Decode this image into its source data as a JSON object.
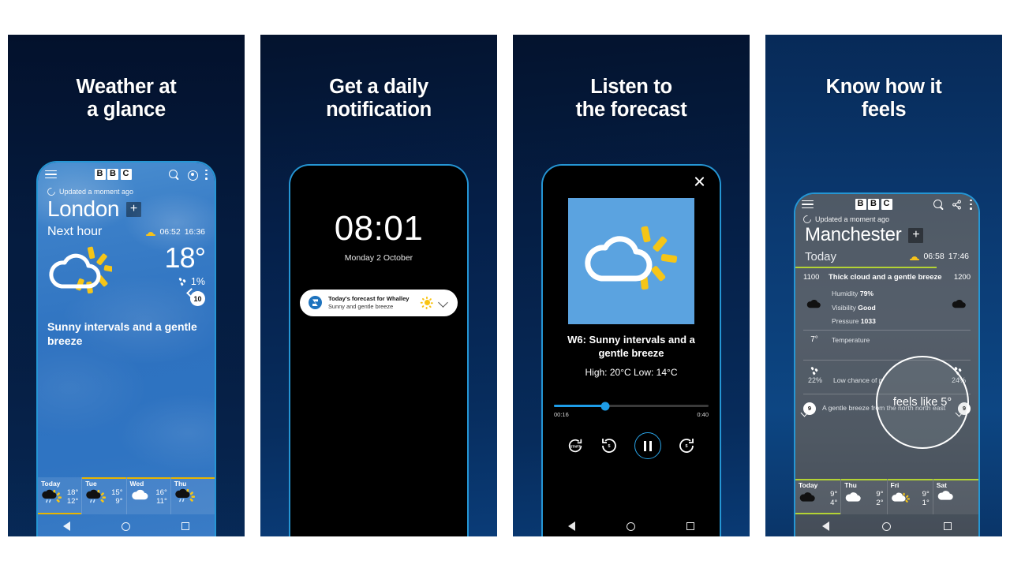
{
  "panels": [
    {
      "id": "weather-at-a-glance",
      "headline": "Weather at\na glance",
      "app": {
        "brand": [
          "B",
          "B",
          "C"
        ],
        "menu_icon": "hamburger-icon",
        "search_icon": "search-icon",
        "location_icon": "location-target-icon",
        "overflow_icon": "more-vertical-icon",
        "updated": "Updated a moment ago",
        "city": "London",
        "add_label": "+",
        "section_label": "Next hour",
        "sunrise": "06:52",
        "sunset": "16:36",
        "temperature": "18°",
        "rain_chance": "1%",
        "wind_speed": "10",
        "summary": "Sunny intervals and\na gentle breeze"
      },
      "forecast": [
        {
          "day": "Today",
          "icon": "sun-rain-cloud",
          "high": "18°",
          "low": "12°",
          "active": true
        },
        {
          "day": "Tue",
          "icon": "sun-rain-cloud",
          "high": "15°",
          "low": "9°",
          "active": false
        },
        {
          "day": "Wed",
          "icon": "cloud",
          "high": "16°",
          "low": "11°",
          "active": false
        },
        {
          "day": "Thu",
          "icon": "sun-rain-cloud",
          "high": "",
          "low": "",
          "active": false
        }
      ]
    },
    {
      "id": "daily-notification",
      "headline": "Get a daily\nnotification",
      "lock": {
        "clock": "08:01",
        "date": "Monday 2 October"
      },
      "notification": {
        "app_icon": "bbc-weather-app-icon",
        "title": "Today's forecast for Whalley",
        "subtitle": "Sunny and gentle breeze",
        "weather_icon": "sun-icon",
        "expand_icon": "chevron-down-icon"
      }
    },
    {
      "id": "listen-to-forecast",
      "headline": "Listen to\nthe forecast",
      "player": {
        "close_icon": "close-icon",
        "artwork_icon": "sun-behind-cloud-icon",
        "title": "W6: Sunny intervals\nand a gentle breeze",
        "subtitle": "High: 20°C  Low: 14°C",
        "elapsed": "00:16",
        "duration": "0:40",
        "progress_pct": 33,
        "restart_label": "START",
        "rewind_label": "5",
        "forward_label": "5",
        "play_state": "pause"
      }
    },
    {
      "id": "know-how-it-feels",
      "headline": "Know how it\nfeels",
      "app": {
        "brand": [
          "B",
          "B",
          "C"
        ],
        "menu_icon": "hamburger-icon",
        "search_icon": "search-icon",
        "share_icon": "share-icon",
        "overflow_icon": "more-vertical-icon",
        "updated": "Updated a moment ago",
        "city": "Manchester",
        "add_label": "+",
        "section_label": "Today",
        "sunrise": "06:58",
        "sunset": "17:46",
        "hour_left": "1100",
        "hour_right": "1200",
        "hour_desc": "Thick cloud and a gentle breeze",
        "details": [
          {
            "label": "Humidity",
            "value": "79%"
          },
          {
            "label": "Visibility",
            "value": "Good"
          },
          {
            "label": "Pressure",
            "value": "1033"
          },
          {
            "label": "Temperature",
            "value": ""
          }
        ],
        "temp_left": "7°",
        "precip_label": "Low chance of p",
        "precip_left": "22%",
        "precip_right": "24%",
        "wind_desc": "A gentle breeze from the north north east",
        "wind_left": "9",
        "wind_right": "9",
        "feels_like": "feels like 5°"
      },
      "forecast": [
        {
          "day": "Today",
          "icon": "cloud",
          "high": "9°",
          "low": "4°",
          "active": true
        },
        {
          "day": "Thu",
          "icon": "cloud",
          "high": "9°",
          "low": "2°",
          "active": false
        },
        {
          "day": "Fri",
          "icon": "sun-cloud",
          "high": "9°",
          "low": "1°",
          "active": false
        },
        {
          "day": "Sat",
          "icon": "cloud",
          "high": "",
          "low": "",
          "active": false
        }
      ]
    }
  ],
  "nav": {
    "back_icon": "back-triangle-icon",
    "home_icon": "home-circle-icon",
    "recents_icon": "recents-square-icon"
  },
  "colors": {
    "page_bg": "#ffffff",
    "panel_dark": "#041a3c",
    "phone_border": "#2596d4",
    "accent_yellow": "#e8b500",
    "accent_green": "#b3d334",
    "accent_blue": "#1e9de8",
    "sky_blue": "#3b7fc8",
    "artwork_blue": "#5ba3e0"
  }
}
